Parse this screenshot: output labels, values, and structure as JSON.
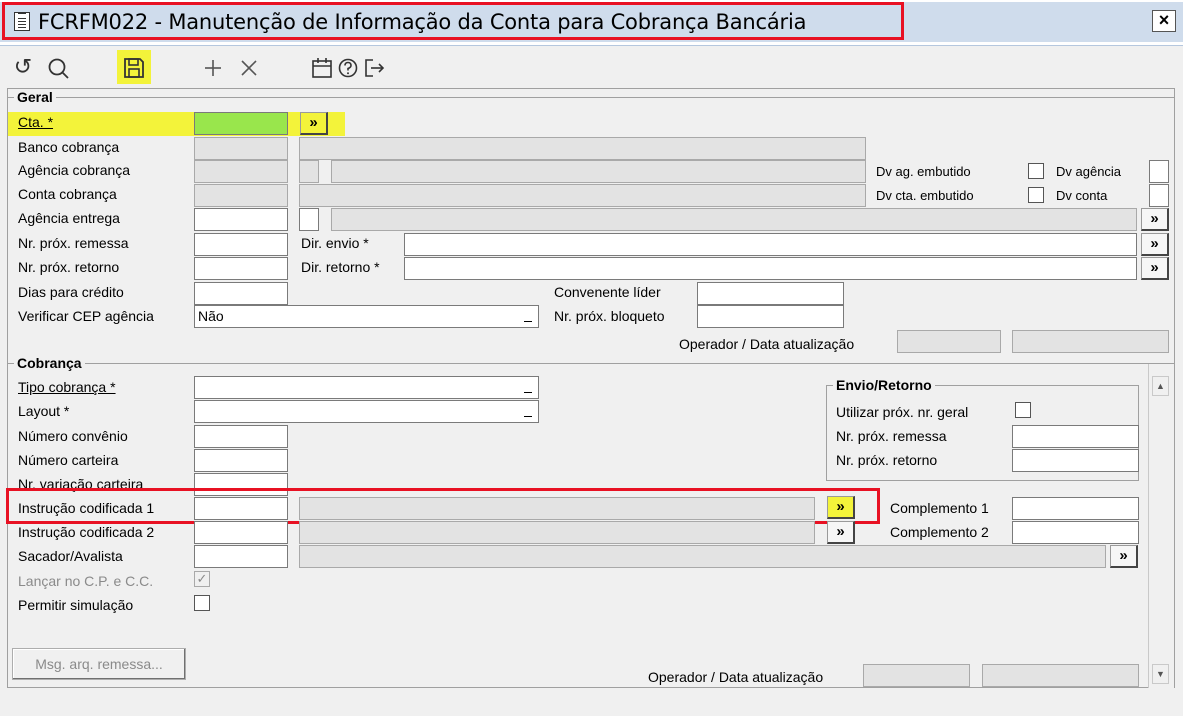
{
  "window": {
    "title": "FCRFM022 - Manutenção de Informação da Conta para Cobrança Bancária",
    "close_label": "×"
  },
  "toolbar": {
    "refresh_glyph": "↺",
    "search_glyph": "🔍",
    "save_glyph": "🖫",
    "add_glyph": "+",
    "delete_glyph": "×",
    "calendar_glyph": "📅",
    "help_glyph": "?",
    "exit_glyph": "↦"
  },
  "geral": {
    "legend": "Geral",
    "cta_label": "Cta. *",
    "banco_label": "Banco cobrança",
    "agencia_cobranca_label": "Agência cobrança",
    "conta_cobranca_label": "Conta cobrança",
    "agencia_entrega_label": "Agência entrega",
    "nr_prox_remessa_label": "Nr. próx. remessa",
    "nr_prox_retorno_label": "Nr. próx. retorno",
    "dias_credito_label": "Dias para crédito",
    "verificar_cep_label": "Verificar CEP agência",
    "verificar_cep_value": "Não",
    "dv_ag_embutido_label": "Dv ag. embutido",
    "dv_agencia_label": "Dv agência",
    "dv_cta_embutido_label": "Dv cta. embutido",
    "dv_conta_label": "Dv conta",
    "dir_envio_label": "Dir. envio *",
    "dir_retorno_label": "Dir. retorno *",
    "convenente_label": "Convenente líder",
    "nr_prox_bloqueto_label": "Nr. próx. bloqueto",
    "operador_label": "Operador / Data atualização"
  },
  "cobranca": {
    "legend": "Cobrança",
    "tipo_label": "Tipo cobrança *",
    "layout_label": "Layout *",
    "numero_convenio_label": "Número convênio",
    "numero_carteira_label": "Número carteira",
    "nr_variacao_label": "Nr. variação carteira",
    "instrucao1_label": "Instrução codificada 1",
    "instrucao2_label": "Instrução codificada 2",
    "sacador_label": "Sacador/Avalista",
    "lancar_label": "Lançar no C.P. e C.C.",
    "permitir_label": "Permitir simulação",
    "complemento1_label": "Complemento 1",
    "complemento2_label": "Complemento 2",
    "msg_button": "Msg. arq. remessa...",
    "operador_label": "Operador / Data atualização"
  },
  "envio_retorno": {
    "legend": "Envio/Retorno",
    "utilizar_label": "Utilizar próx. nr. geral",
    "nr_prox_remessa_label": "Nr. próx. remessa",
    "nr_prox_retorno_label": "Nr. próx. retorno"
  },
  "more_glyph": "»",
  "check_glyph": "✓",
  "colors": {
    "highlight_yellow": "#f3f33a",
    "required_green": "#99e64c",
    "annotation_red": "#e81123",
    "title_bar": "#cfdcec"
  }
}
